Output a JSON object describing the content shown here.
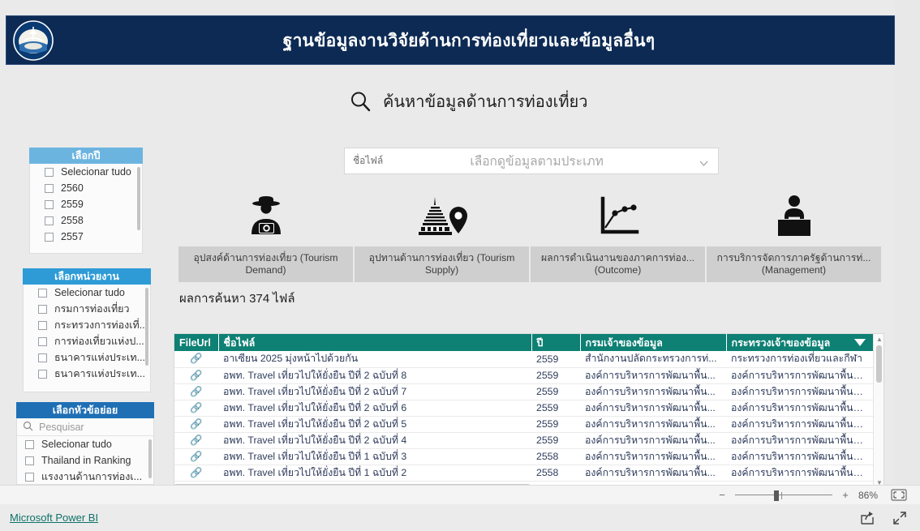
{
  "header": {
    "title": "ฐานข้อมูลงานวิจัยด้านการท่องเที่ยวและข้อมูลอื่นๆ",
    "logo_icon": "government-emblem-icon",
    "background": "#0d2a54"
  },
  "search_heading": {
    "icon": "magnifier-icon",
    "text": "ค้นหาข้อมูลด้านการท่องเที่ยว"
  },
  "slicers": [
    {
      "name": "year",
      "title": "เลือกปี",
      "header_color": "#6cb4e0",
      "items": [
        "Selecionar tudo",
        "2560",
        "2559",
        "2558",
        "2557"
      ]
    },
    {
      "name": "agency",
      "title": "เลือกหน่วยงาน",
      "header_color": "#2e9bd6",
      "items": [
        "Selecionar tudo",
        "กรมการท่องเที่ยว",
        "กระทรวงการท่องเที่...",
        "การท่องเที่ยวแห่งป...",
        "ธนาคารแห่งประเท...",
        "ธนาคารแห่งประเท..."
      ]
    },
    {
      "name": "subtopic",
      "title": "เลือกหัวข้อย่อย",
      "header_color": "#1f6fb5",
      "search_placeholder": "Pesquisar",
      "search_icon": "search-icon",
      "items": [
        "Selecionar tudo",
        "Thailand in Ranking",
        "แรงงานด้านการท่องเ..."
      ]
    }
  ],
  "dropdown": {
    "label": "ชื่อไฟล์",
    "placeholder": "เลือกดูข้อมูลตามประเภท",
    "caret_icon": "chevron-down-icon"
  },
  "cards": [
    {
      "icon": "tourist-photographer-icon",
      "label": "อุปสงค์ด้านการท่องเที่ยว (Tourism Demand)"
    },
    {
      "icon": "pagoda-location-pin-icon",
      "label": "อุปทานด้านการท่องเที่ยว (Tourism Supply)"
    },
    {
      "icon": "line-chart-icon",
      "label": "ผลการดำเนินงานของภาคการท่อง... (Outcome)"
    },
    {
      "icon": "government-official-desk-icon",
      "label": "การบริการจัดการภาครัฐด้านการท่... (Management)"
    }
  ],
  "results": {
    "prefix": "ผลการค้นหา",
    "count": "374",
    "suffix": "ไฟล์"
  },
  "table": {
    "columns": [
      "FileUrl",
      "ชื่อไฟล์",
      "ปี",
      "กรมเจ้าของข้อมูล",
      "กระทรวงเจ้าของข้อมูล"
    ],
    "header_color": "#0e8074",
    "sort_icon": "sort-descending-caret-icon",
    "link_icon": "link-icon",
    "rows": [
      {
        "url": "🔗",
        "filename": "อาเซียน 2025 มุ่งหน้าไปด้วยกัน",
        "year": "2559",
        "department": "สำนักงานปลัดกระทรวงการท่...",
        "ministry": "กระทรวงการท่องเที่ยวและกีฬา"
      },
      {
        "url": "🔗",
        "filename": "อพท. Travel เที่ยวไปให้ยั่งยืน ปีที่ 2 ฉบับที่ 8",
        "year": "2559",
        "department": "องค์การบริหารการพัฒนาพื้น...",
        "ministry": "องค์การบริหารการพัฒนาพื้นที่พิเ..."
      },
      {
        "url": "🔗",
        "filename": "อพท. Travel เที่ยวไปให้ยั่งยืน ปีที่ 2 ฉบับที่ 7",
        "year": "2559",
        "department": "องค์การบริหารการพัฒนาพื้น...",
        "ministry": "องค์การบริหารการพัฒนาพื้นที่พิเ..."
      },
      {
        "url": "🔗",
        "filename": "อพท. Travel เที่ยวไปให้ยั่งยืน ปีที่ 2 ฉบับที่ 6",
        "year": "2559",
        "department": "องค์การบริหารการพัฒนาพื้น...",
        "ministry": "องค์การบริหารการพัฒนาพื้นที่พิเ..."
      },
      {
        "url": "🔗",
        "filename": "อพท. Travel เที่ยวไปให้ยั่งยืน ปีที่ 2 ฉบับที่ 5",
        "year": "2559",
        "department": "องค์การบริหารการพัฒนาพื้น...",
        "ministry": "องค์การบริหารการพัฒนาพื้นที่พิเ..."
      },
      {
        "url": "🔗",
        "filename": "อพท. Travel เที่ยวไปให้ยั่งยืน ปีที่ 2 ฉบับที่ 4",
        "year": "2559",
        "department": "องค์การบริหารการพัฒนาพื้น...",
        "ministry": "องค์การบริหารการพัฒนาพื้นที่พิเ..."
      },
      {
        "url": "🔗",
        "filename": "อพท. Travel เที่ยวไปให้ยั่งยืน ปีที่ 1 ฉบับที่ 3",
        "year": "2558",
        "department": "องค์การบริหารการพัฒนาพื้น...",
        "ministry": "องค์การบริหารการพัฒนาพื้นที่พิเ..."
      },
      {
        "url": "🔗",
        "filename": "อพท. Travel เที่ยวไปให้ยั่งยืน ปีที่ 1 ฉบับที่ 2",
        "year": "2558",
        "department": "องค์การบริหารการพัฒนาพื้น...",
        "ministry": "องค์การบริหารการพัฒนาพื้นที่พิเ..."
      }
    ]
  },
  "zoombar": {
    "minus": "−",
    "plus": "+",
    "value": "86%",
    "fit_icon": "fit-to-page-icon"
  },
  "footer": {
    "powerbi_label": "Microsoft Power BI",
    "share_icon": "share-icon",
    "fullscreen_icon": "fullscreen-icon"
  }
}
